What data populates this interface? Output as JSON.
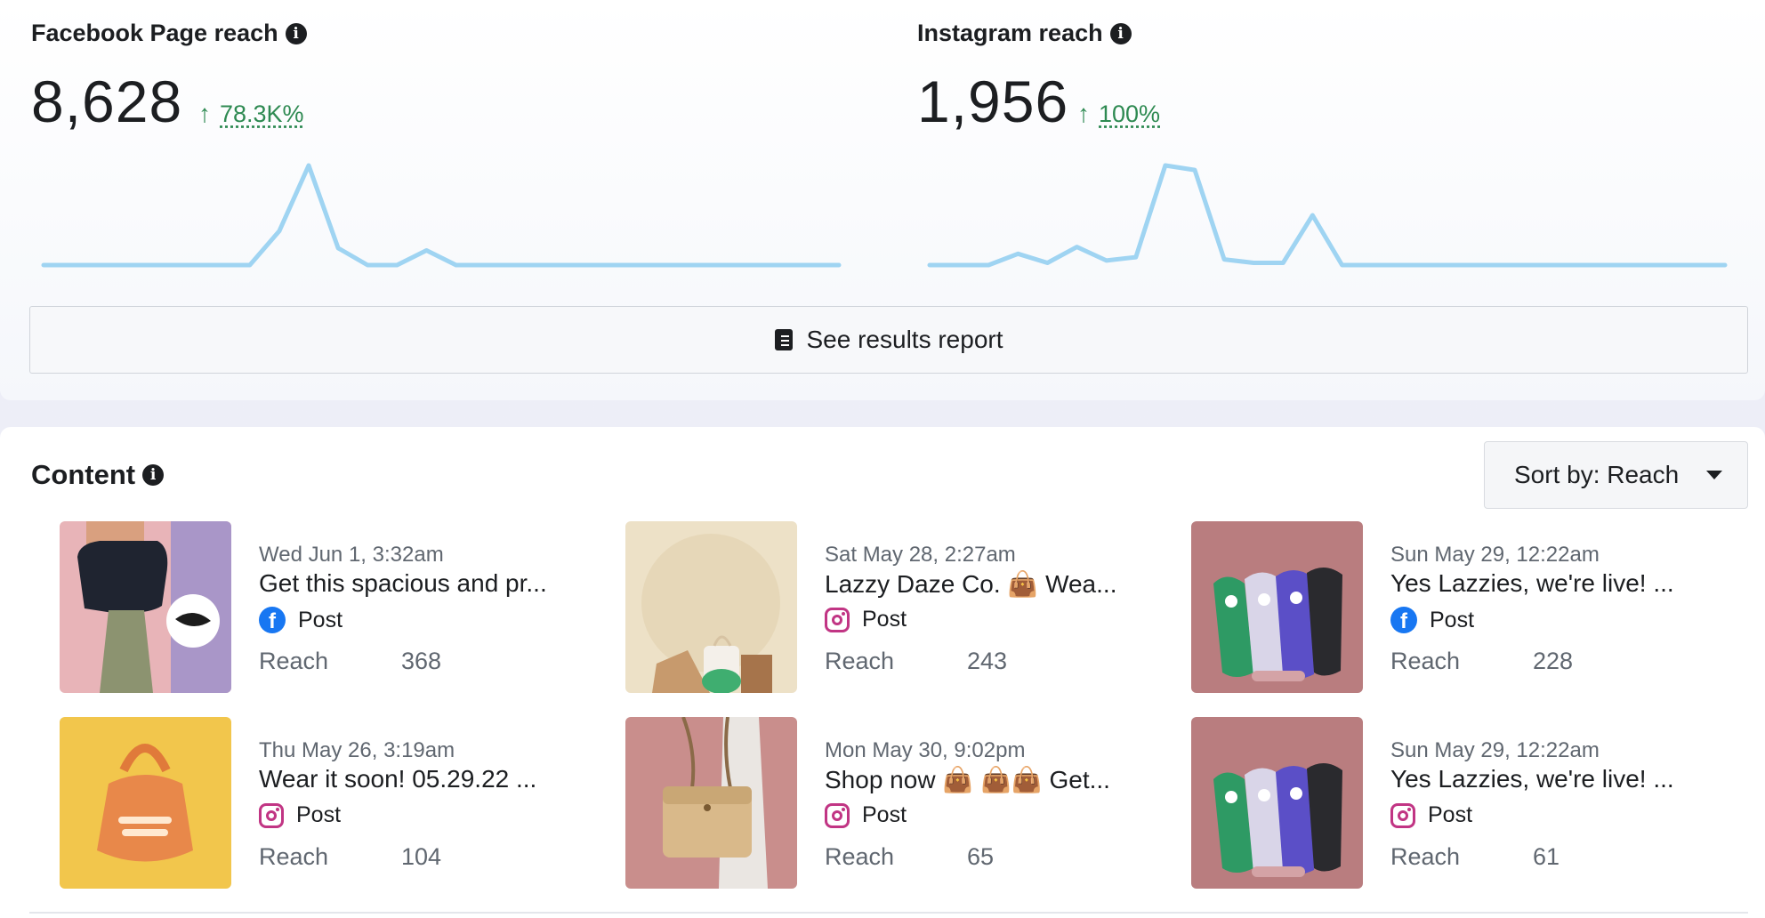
{
  "facebook": {
    "title": "Facebook Page reach",
    "value": "8,628",
    "change": "78.3K%",
    "sparkline": [
      0,
      0,
      0,
      0,
      0,
      0,
      0,
      0,
      30,
      88,
      15,
      0,
      0,
      13,
      0,
      0,
      0,
      0,
      0,
      0,
      0,
      0,
      0,
      0,
      0,
      0,
      0,
      0
    ]
  },
  "instagram": {
    "title": "Instagram reach",
    "value": "1,956",
    "change": "100%",
    "sparkline": [
      0,
      0,
      0,
      10,
      2,
      16,
      4,
      7,
      88,
      84,
      5,
      2,
      2,
      44,
      0,
      0,
      0,
      0,
      0,
      0,
      0,
      0,
      0,
      0,
      0,
      0,
      0,
      0
    ]
  },
  "report_button": {
    "label": "See results report"
  },
  "content": {
    "title": "Content",
    "sort_label": "Sort by: Reach",
    "reach_label": "Reach",
    "posts": [
      {
        "date": "Wed Jun 1, 3:32am",
        "text": "Get this spacious and pr...",
        "platform": "facebook",
        "type": "Post",
        "reach": "368"
      },
      {
        "date": "Sat May 28, 2:27am",
        "text": "Lazzy Daze Co. 👜 Wea...",
        "platform": "instagram",
        "type": "Post",
        "reach": "243"
      },
      {
        "date": "Sun May 29, 12:22am",
        "text": "Yes Lazzies, we're live! ...",
        "platform": "facebook",
        "type": "Post",
        "reach": "228"
      },
      {
        "date": "Thu May 26, 3:19am",
        "text": "Wear it soon! 05.29.22 ...",
        "platform": "instagram",
        "type": "Post",
        "reach": "104"
      },
      {
        "date": "Mon May 30, 9:02pm",
        "text": "Shop now 👜 👜👜 Get...",
        "platform": "instagram",
        "type": "Post",
        "reach": "65"
      },
      {
        "date": "Sun May 29, 12:22am",
        "text": "Yes Lazzies, we're live! ...",
        "platform": "instagram",
        "type": "Post",
        "reach": "61"
      }
    ]
  },
  "colors": {
    "sparkline": "#9fd4f2",
    "positive": "#2e8a52",
    "facebook": "#1877f2",
    "instagram": "#c13584"
  }
}
